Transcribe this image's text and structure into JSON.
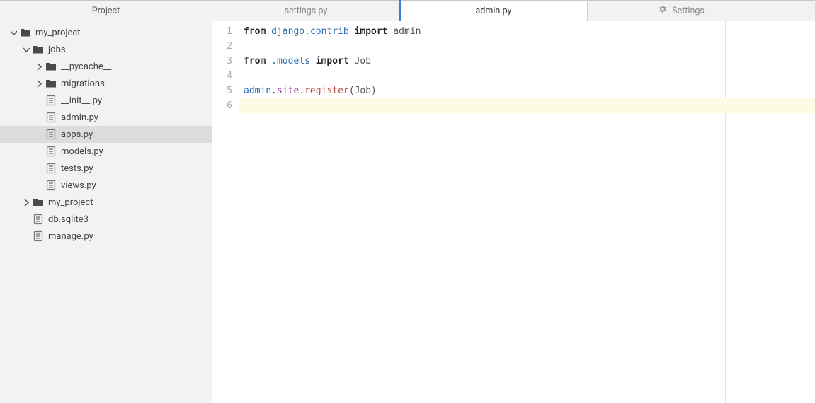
{
  "sidebar": {
    "title": "Project",
    "tree": [
      {
        "depth": 0,
        "expander": "down",
        "icon": "folder",
        "label": "my_project",
        "selected": false
      },
      {
        "depth": 1,
        "expander": "down",
        "icon": "folder",
        "label": "jobs",
        "selected": false
      },
      {
        "depth": 2,
        "expander": "right",
        "icon": "folder",
        "label": "__pycache__",
        "selected": false
      },
      {
        "depth": 2,
        "expander": "right",
        "icon": "folder",
        "label": "migrations",
        "selected": false
      },
      {
        "depth": 2,
        "expander": "none",
        "icon": "file",
        "label": "__init__.py",
        "selected": false
      },
      {
        "depth": 2,
        "expander": "none",
        "icon": "file",
        "label": "admin.py",
        "selected": false
      },
      {
        "depth": 2,
        "expander": "none",
        "icon": "file",
        "label": "apps.py",
        "selected": true
      },
      {
        "depth": 2,
        "expander": "none",
        "icon": "file",
        "label": "models.py",
        "selected": false
      },
      {
        "depth": 2,
        "expander": "none",
        "icon": "file",
        "label": "tests.py",
        "selected": false
      },
      {
        "depth": 2,
        "expander": "none",
        "icon": "file",
        "label": "views.py",
        "selected": false
      },
      {
        "depth": 1,
        "expander": "right",
        "icon": "folder",
        "label": "my_project",
        "selected": false
      },
      {
        "depth": 1,
        "expander": "none",
        "icon": "file",
        "label": "db.sqlite3",
        "selected": false
      },
      {
        "depth": 1,
        "expander": "none",
        "icon": "file",
        "label": "manage.py",
        "selected": false
      }
    ]
  },
  "tabs": [
    {
      "label": "settings.py",
      "active": false,
      "icon": "none"
    },
    {
      "label": "admin.py",
      "active": true,
      "icon": "none"
    },
    {
      "label": "Settings",
      "active": false,
      "icon": "gear"
    }
  ],
  "editor": {
    "filename": "admin.py",
    "lines": [
      {
        "n": 1,
        "tokens": [
          {
            "t": "from ",
            "c": "kw"
          },
          {
            "t": "django",
            "c": "mod"
          },
          {
            "t": ".",
            "c": "plain"
          },
          {
            "t": "contrib",
            "c": "mod"
          },
          {
            "t": " import ",
            "c": "kw"
          },
          {
            "t": "admin",
            "c": "plain"
          }
        ]
      },
      {
        "n": 2,
        "tokens": []
      },
      {
        "n": 3,
        "tokens": [
          {
            "t": "from ",
            "c": "kw"
          },
          {
            "t": ".models",
            "c": "mod"
          },
          {
            "t": " import ",
            "c": "kw"
          },
          {
            "t": "Job",
            "c": "plain"
          }
        ]
      },
      {
        "n": 4,
        "tokens": []
      },
      {
        "n": 5,
        "tokens": [
          {
            "t": "admin",
            "c": "mod"
          },
          {
            "t": ".",
            "c": "plain"
          },
          {
            "t": "site",
            "c": "attr"
          },
          {
            "t": ".",
            "c": "plain"
          },
          {
            "t": "register",
            "c": "call"
          },
          {
            "t": "(",
            "c": "paren"
          },
          {
            "t": "Job",
            "c": "plain"
          },
          {
            "t": ")",
            "c": "paren"
          }
        ]
      },
      {
        "n": 6,
        "tokens": [],
        "current": true
      }
    ]
  }
}
